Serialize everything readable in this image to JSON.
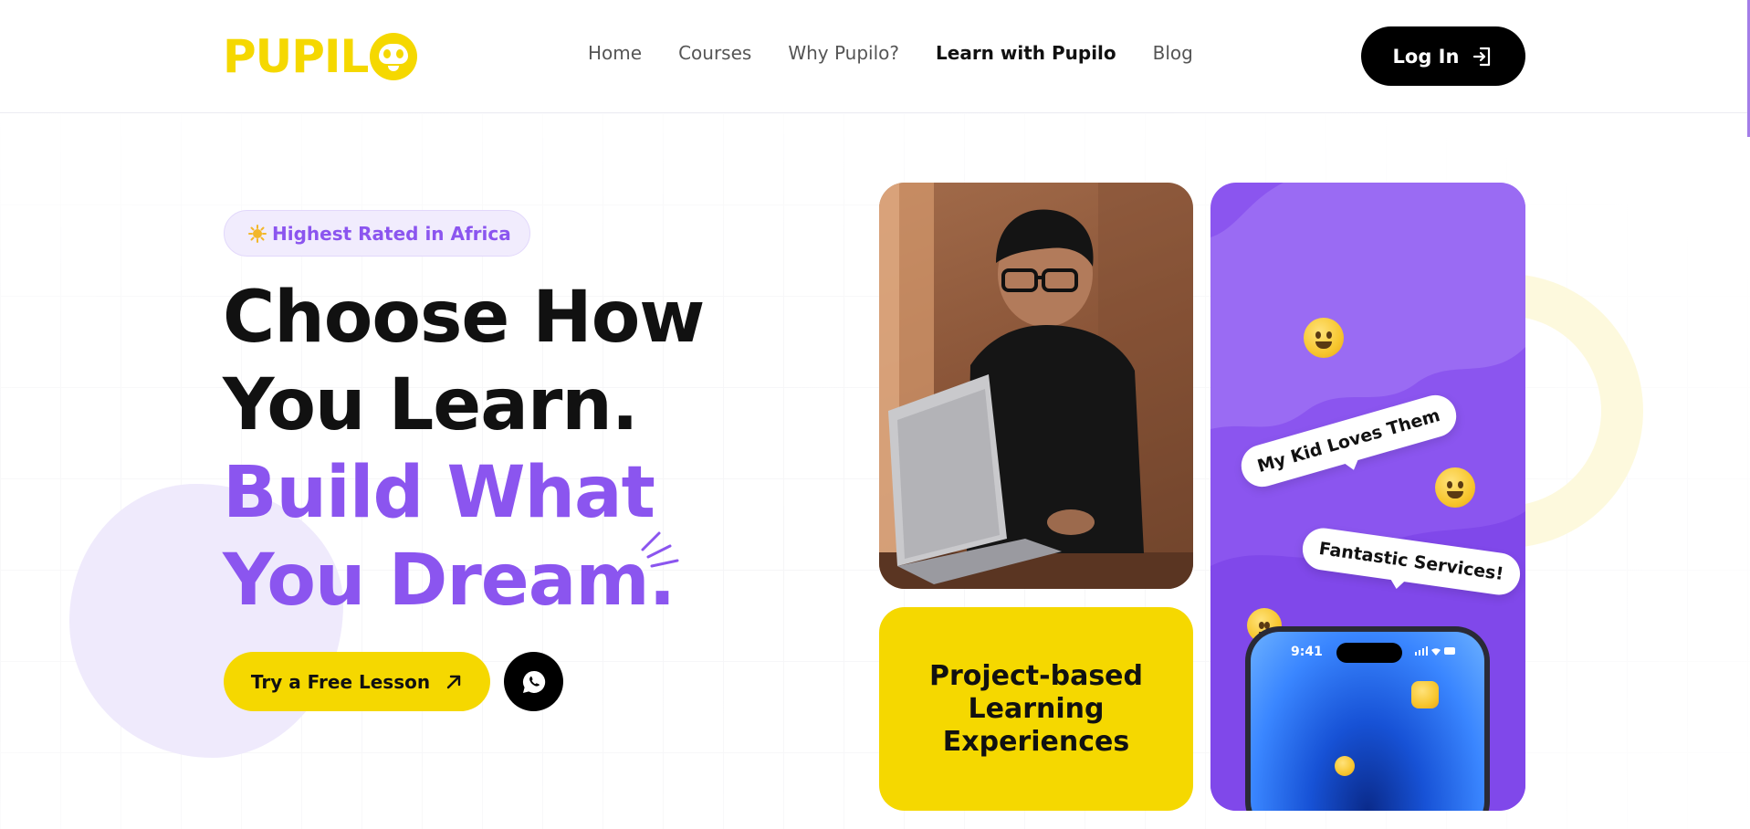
{
  "header": {
    "logo_text": "PUPIL",
    "nav": [
      {
        "label": "Home",
        "active": false
      },
      {
        "label": "Courses",
        "active": false
      },
      {
        "label": "Why Pupilo?",
        "active": false
      },
      {
        "label": "Learn with Pupilo",
        "active": true
      },
      {
        "label": "Blog",
        "active": false
      }
    ],
    "login_label": "Log In"
  },
  "hero": {
    "badge": "Highest Rated in Africa",
    "headline_line1": "Choose How",
    "headline_line2": "You Learn.",
    "headline_line3": "Build What",
    "headline_line4": "You Dream.",
    "cta_label": "Try a Free Lesson"
  },
  "cards": {
    "yellow_text": "Project-based Learning Experiences",
    "bubble1": "My Kid Loves Them",
    "bubble2": "Fantastic Services!",
    "phone_time": "9:41"
  },
  "colors": {
    "brand_yellow": "#f5d800",
    "brand_purple": "#8b55ef",
    "black": "#000000"
  }
}
